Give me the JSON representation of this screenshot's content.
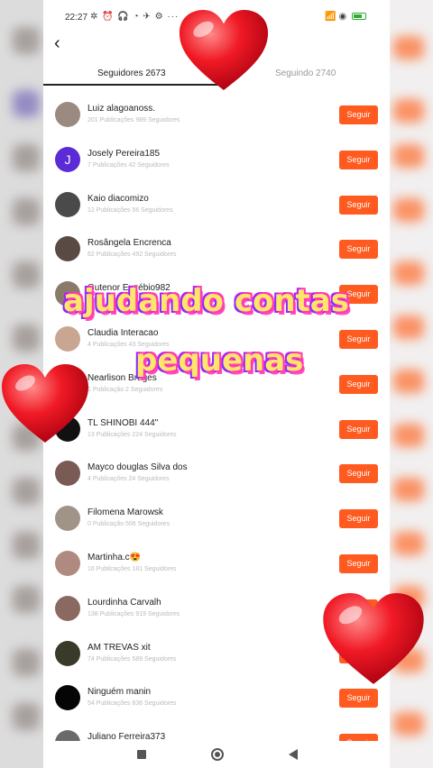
{
  "status_bar": {
    "time": "22:27",
    "icons_left": "✲ ⏰ 🎧 ◔ ✈ ⚙ ···",
    "icons_right": "📶 ◉"
  },
  "tabs": {
    "followers": "Seguidores 2673",
    "following": "Seguindo 2740"
  },
  "follow_label": "Seguir",
  "users": [
    {
      "name": "Luiz alagoanoss.",
      "meta": "201 Publicações   989 Seguidores",
      "avatar": "",
      "avatar_color": "#9a8a80"
    },
    {
      "name": "Josely Pereira185",
      "meta": "7 Publicações   42 Seguidores",
      "avatar": "J",
      "avatar_color": "#5a2bd6"
    },
    {
      "name": "Kaio diacomizo",
      "meta": "12 Publicações   56 Seguidores",
      "avatar": "",
      "avatar_color": "#4a4a4a"
    },
    {
      "name": "Rosângela Encrenca",
      "meta": "62 Publicações   492 Seguidores",
      "avatar": "",
      "avatar_color": "#5a4a44"
    },
    {
      "name": "Gutenor Euzébio982",
      "meta": "",
      "avatar": "",
      "avatar_color": "#8a7a6a"
    },
    {
      "name": "Claudia Interacao",
      "meta": "4 Publicações   43 Seguidores",
      "avatar": "",
      "avatar_color": "#c9a692"
    },
    {
      "name": "Nearlison Bruges",
      "meta": "1 Publicação   2 Seguidores",
      "avatar": "",
      "avatar_color": "#6a5a50"
    },
    {
      "name": "TL SHINOBI 444\"",
      "meta": "13 Publicações   224 Seguidores",
      "avatar": "",
      "avatar_color": "#111111"
    },
    {
      "name": "Mayco douglas Silva dos",
      "meta": "4 Publicações   24 Seguidores",
      "avatar": "",
      "avatar_color": "#7a5a54"
    },
    {
      "name": "Filomena Marowsk",
      "meta": "0 Publicação   506 Seguidores",
      "avatar": "",
      "avatar_color": "#a09488"
    },
    {
      "name": "Martinha.c😍",
      "meta": "16 Publicações   181 Seguidores",
      "avatar": "",
      "avatar_color": "#b08a80"
    },
    {
      "name": "Lourdinha Carvalh",
      "meta": "138 Publicações   919 Seguidores",
      "avatar": "",
      "avatar_color": "#8a6a60"
    },
    {
      "name": "AM TREVAS xit",
      "meta": "74 Publicações   589 Seguidores",
      "avatar": "",
      "avatar_color": "#3a3a2a"
    },
    {
      "name": "Ninguém manin",
      "meta": "54 Publicações   836 Seguidores",
      "avatar": "",
      "avatar_color": "#050505"
    },
    {
      "name": "Juliano Ferreira373",
      "meta": "",
      "avatar": "",
      "avatar_color": "#6a6a6a"
    }
  ],
  "overlay": {
    "line1": "ajudando contas",
    "line2": "pequenas"
  },
  "colors": {
    "accent": "#ff5a1f",
    "heart": "#e8121f"
  }
}
